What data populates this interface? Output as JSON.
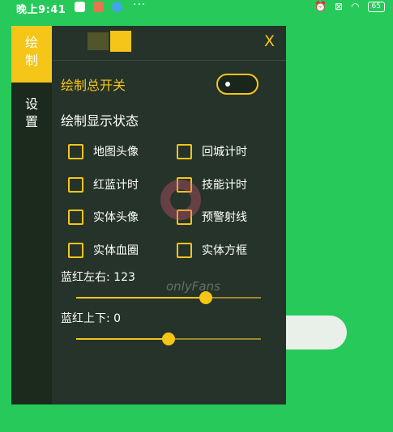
{
  "status_bar": {
    "time": "晚上9:41",
    "more": "···",
    "battery": "65",
    "icons": [
      "penguin-icon",
      "app-icon",
      "cloud-icon",
      "alarm-icon",
      "no-sim-icon",
      "wifi-icon",
      "battery-icon"
    ]
  },
  "sidebar": {
    "tabs": [
      {
        "label": "绘\n制",
        "active": true
      },
      {
        "label": "设\n置",
        "active": false
      }
    ]
  },
  "panel": {
    "close_label": "X",
    "master_switch_label": "绘制总开关",
    "master_switch_on": true,
    "section_title": "绘制显示状态",
    "options": [
      {
        "label": "地图头像",
        "checked": false
      },
      {
        "label": "回城计时",
        "checked": false
      },
      {
        "label": "红蓝计时",
        "checked": false
      },
      {
        "label": "技能计时",
        "checked": false
      },
      {
        "label": "实体头像",
        "checked": false
      },
      {
        "label": "预警射线",
        "checked": false
      },
      {
        "label": "实体血圈",
        "checked": false
      },
      {
        "label": "实体方框",
        "checked": false
      }
    ],
    "sliders": [
      {
        "label": "蓝红左右: 123",
        "fraction": 0.7
      },
      {
        "label": "蓝红上下: 0",
        "fraction": 0.5
      }
    ]
  },
  "watermark_text": "onlyFans",
  "colors": {
    "accent": "#f5c518",
    "panel": "#26332a",
    "background": "#27c95a"
  }
}
